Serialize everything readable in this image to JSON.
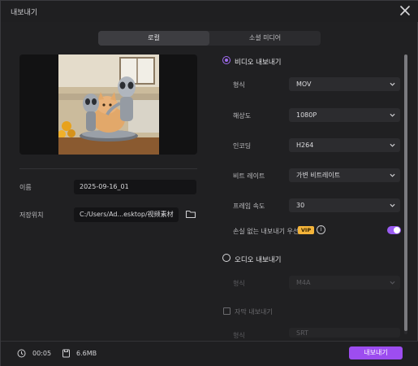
{
  "window": {
    "title": "내보내기"
  },
  "tabs": [
    {
      "label": "로컬",
      "active": true
    },
    {
      "label": "소셜 미디어",
      "active": false
    }
  ],
  "file": {
    "name_label": "이름",
    "name_value": "2025-09-16_01",
    "location_label": "저장위치",
    "location_value": "C:/Users/Ad...esktop/视频素材"
  },
  "video": {
    "section_label": "비디오 내보내기",
    "format_label": "형식",
    "format_value": "MOV",
    "resolution_label": "해상도",
    "resolution_value": "1080P",
    "encoding_label": "인코딩",
    "encoding_value": "H264",
    "bitrate_label": "비트 레이트",
    "bitrate_value": "가변 비트레이트",
    "framerate_label": "프레임 속도",
    "framerate_value": "30",
    "lossless_label": "손실 없는 내보내기 우선",
    "vip_badge": "VIP",
    "info_glyph": "i",
    "lossless_on": true
  },
  "audio": {
    "section_label": "오디오 내보내기",
    "format_label": "형식",
    "format_value": "M4A"
  },
  "subtitle": {
    "section_label": "자막 내보내기",
    "format_label": "형식",
    "format_value": "SRT"
  },
  "footer": {
    "duration": "00:05",
    "size": "6.6MB",
    "export_label": "내보내기"
  },
  "colors": {
    "accent": "#9d4df0",
    "vip": "#f4b43a",
    "background": "#202022"
  },
  "icons": [
    "close-icon",
    "folder-icon",
    "clock-icon",
    "file-size-icon",
    "chevron-down-icon",
    "info-icon"
  ]
}
